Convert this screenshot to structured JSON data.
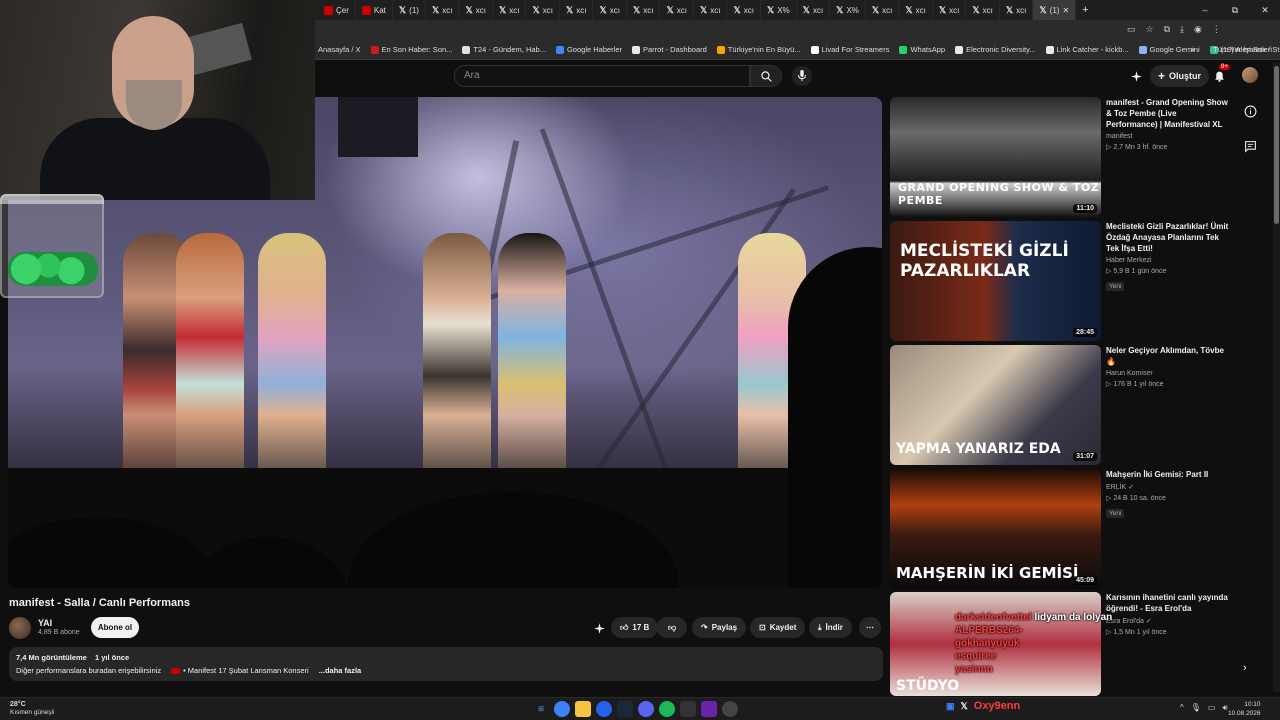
{
  "browser": {
    "tabs": [
      {
        "icon": "youtube",
        "label": "Çer"
      },
      {
        "icon": "youtube",
        "label": "Kat"
      },
      {
        "icon": "x",
        "label": "(1)"
      },
      {
        "icon": "x",
        "label": "xcı"
      },
      {
        "icon": "x",
        "label": "xcı"
      },
      {
        "icon": "x",
        "label": "xcı"
      },
      {
        "icon": "x",
        "label": "xcı"
      },
      {
        "icon": "x",
        "label": "xcı"
      },
      {
        "icon": "x",
        "label": "xcı"
      },
      {
        "icon": "x",
        "label": "xcı"
      },
      {
        "icon": "x",
        "label": "xcı"
      },
      {
        "icon": "x",
        "label": "xcı"
      },
      {
        "icon": "x",
        "label": "xcı"
      },
      {
        "icon": "x",
        "label": "X%"
      },
      {
        "icon": "x",
        "label": "xcı"
      },
      {
        "icon": "x",
        "label": "X%"
      },
      {
        "icon": "x",
        "label": "xcı"
      },
      {
        "icon": "x",
        "label": "xcı"
      },
      {
        "icon": "x",
        "label": "xcı"
      },
      {
        "icon": "x",
        "label": "xcı"
      },
      {
        "icon": "x",
        "label": "xcı"
      },
      {
        "icon": "x",
        "label": "(1)"
      }
    ],
    "new_tab": "+",
    "win_controls": [
      "–",
      "⧉",
      "✕"
    ],
    "bookmarks": [
      {
        "label": "Anasayfa / X",
        "color": ""
      },
      {
        "label": "En Son Haber: Son...",
        "color": "#cc1b1b"
      },
      {
        "label": "T24 - Gündem, Hab...",
        "color": "#e0e0e0"
      },
      {
        "label": "Google Haberler",
        "color": "#4285f4"
      },
      {
        "label": "Parrot - Dashboard",
        "color": "#e8e8e8"
      },
      {
        "label": "Türkiye'nin En Büyü...",
        "color": "#f7a600"
      },
      {
        "label": "Livad For Streamers",
        "color": "#ffffff"
      },
      {
        "label": "WhatsApp",
        "color": "#25d366"
      },
      {
        "label": "Electronic Diversity...",
        "color": "#e8e8e8"
      },
      {
        "label": "Link Catcher - kickb...",
        "color": "#e8e8e8"
      },
      {
        "label": "Google Gemini",
        "color": "#8ab4f8"
      },
      {
        "label": "(19) Alert Box / Stre...",
        "color": "#31c48d"
      }
    ],
    "all_bookmarks": "Tüm Yer İşaretleri"
  },
  "header": {
    "search_placeholder": "Ara",
    "create_label": "Oluştur",
    "notif_count": "9+"
  },
  "video": {
    "title": "manifest - Salla / Canlı Performans",
    "channel": "YAI",
    "subscribers": "4,89 B abone",
    "subscribe_label": "Abone ol",
    "likes": "17 B",
    "share_label": "Paylaş",
    "save_label": "Kaydet",
    "download_label": "İndir",
    "views": "7,4 Mn görüntüleme",
    "age": "1 yıl önce",
    "desc_line": "Diğer performanslara buradan erişebilirsiniz",
    "desc_link": "• Manifest 17 Şubat Lansman Konseri",
    "desc_more": "...daha fazla"
  },
  "recommended": [
    {
      "title": "manifest - Grand Opening Show & Toz Pembe (Live Performance) | Manifestival XL",
      "channel": "manifest",
      "views": "2,7 Mn",
      "age": "3 hf. önce",
      "duration": "11:10",
      "badge": "",
      "thumb_text": "GRAND OPENING SHOW & TOZ PEMBE"
    },
    {
      "title": "Meclisteki Gizli Pazarlıklar! Ümit Özdağ Anayasa Planlarını Tek Tek İfşa Etti!",
      "channel": "Haber Merkezi",
      "views": "5,9 B",
      "age": "1 gün önce",
      "duration": "28:45",
      "badge": "Yeni",
      "thumb_text": "MECLİSTEKİ GİZLİ PAZARLIKLAR"
    },
    {
      "title": "Neler Geçiyor Aklımdan, Tövbe 🔥",
      "channel": "Harun Komiser",
      "views": "176 B",
      "age": "1 yıl önce",
      "duration": "31:07",
      "badge": "",
      "thumb_text": "YAPMA YANARIZ EDA"
    },
    {
      "title": "Mahşerin İki Gemisi: Part II",
      "channel": "ERLİK ✓",
      "views": "24 B",
      "age": "10 sa. önce",
      "duration": "45:09",
      "badge": "Yeni",
      "thumb_text": "MAHŞERİN İKİ GEMİSİ"
    },
    {
      "title": "Karısının ihanetini canlı yayında öğrendi! - Esra Erol'da",
      "channel": "Esra Erol'da ✓",
      "views": "1,5 Mn",
      "age": "1 yıl önce",
      "duration": "",
      "badge": "",
      "thumb_text": "STÜDYO"
    }
  ],
  "chat": {
    "line1_red": "darksideofvettel",
    "line1_white": " lidyam da lolyan",
    "line2": "ALPERBS264-",
    "line3": "gokhanyuyuk",
    "line4": "esquiree",
    "line5": "yasinnn"
  },
  "taskbar": {
    "temp": "28°C",
    "weather": "Kısmen güneşli",
    "tray_name": "Oxy9enn",
    "time": "10:10",
    "date": "10.08.2026"
  },
  "colors": {
    "yt_red": "#cc0000",
    "bg": "#0f0f0f",
    "chip": "#272727",
    "chat_red": "#ff3b3b"
  }
}
